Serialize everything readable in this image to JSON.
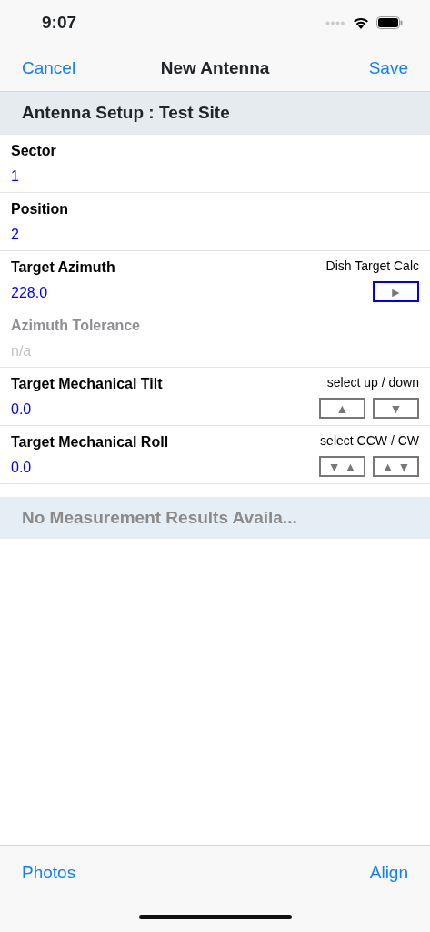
{
  "status_bar": {
    "time": "9:07"
  },
  "nav_bar": {
    "left": "Cancel",
    "title": "New Antenna",
    "right": "Save"
  },
  "section_header": "Antenna Setup : Test Site",
  "rows": [
    {
      "kind": "plain",
      "label": "Sector",
      "value": "1",
      "disabled": false
    },
    {
      "kind": "plain",
      "label": "Position",
      "value": "2",
      "disabled": false
    },
    {
      "kind": "action",
      "label": "Target Azimuth",
      "value": "228.0",
      "disabled": false,
      "hint": "Dish Target Calc",
      "buttons": [
        {
          "glyph": "►",
          "highlighted": true
        }
      ]
    },
    {
      "kind": "plain",
      "label": "Azimuth Tolerance",
      "value": "n/a",
      "disabled": true
    },
    {
      "kind": "stepper",
      "label": "Target Mechanical Tilt",
      "value": "0.0",
      "disabled": false,
      "hint": "select up / down",
      "buttons": [
        {
          "glyph": "▲",
          "highlighted": false
        },
        {
          "glyph": "▼",
          "highlighted": false
        }
      ]
    },
    {
      "kind": "stepper",
      "label": "Target Mechanical Roll",
      "value": "0.0",
      "disabled": false,
      "hint": "select CCW / CW",
      "buttons": [
        {
          "glyph": "▼ ▲",
          "highlighted": false
        },
        {
          "glyph": "▲ ▼",
          "highlighted": false
        }
      ]
    }
  ],
  "results_banner": "No Measurement Results Availa...",
  "toolbar": {
    "left": "Photos",
    "right": "Align"
  }
}
